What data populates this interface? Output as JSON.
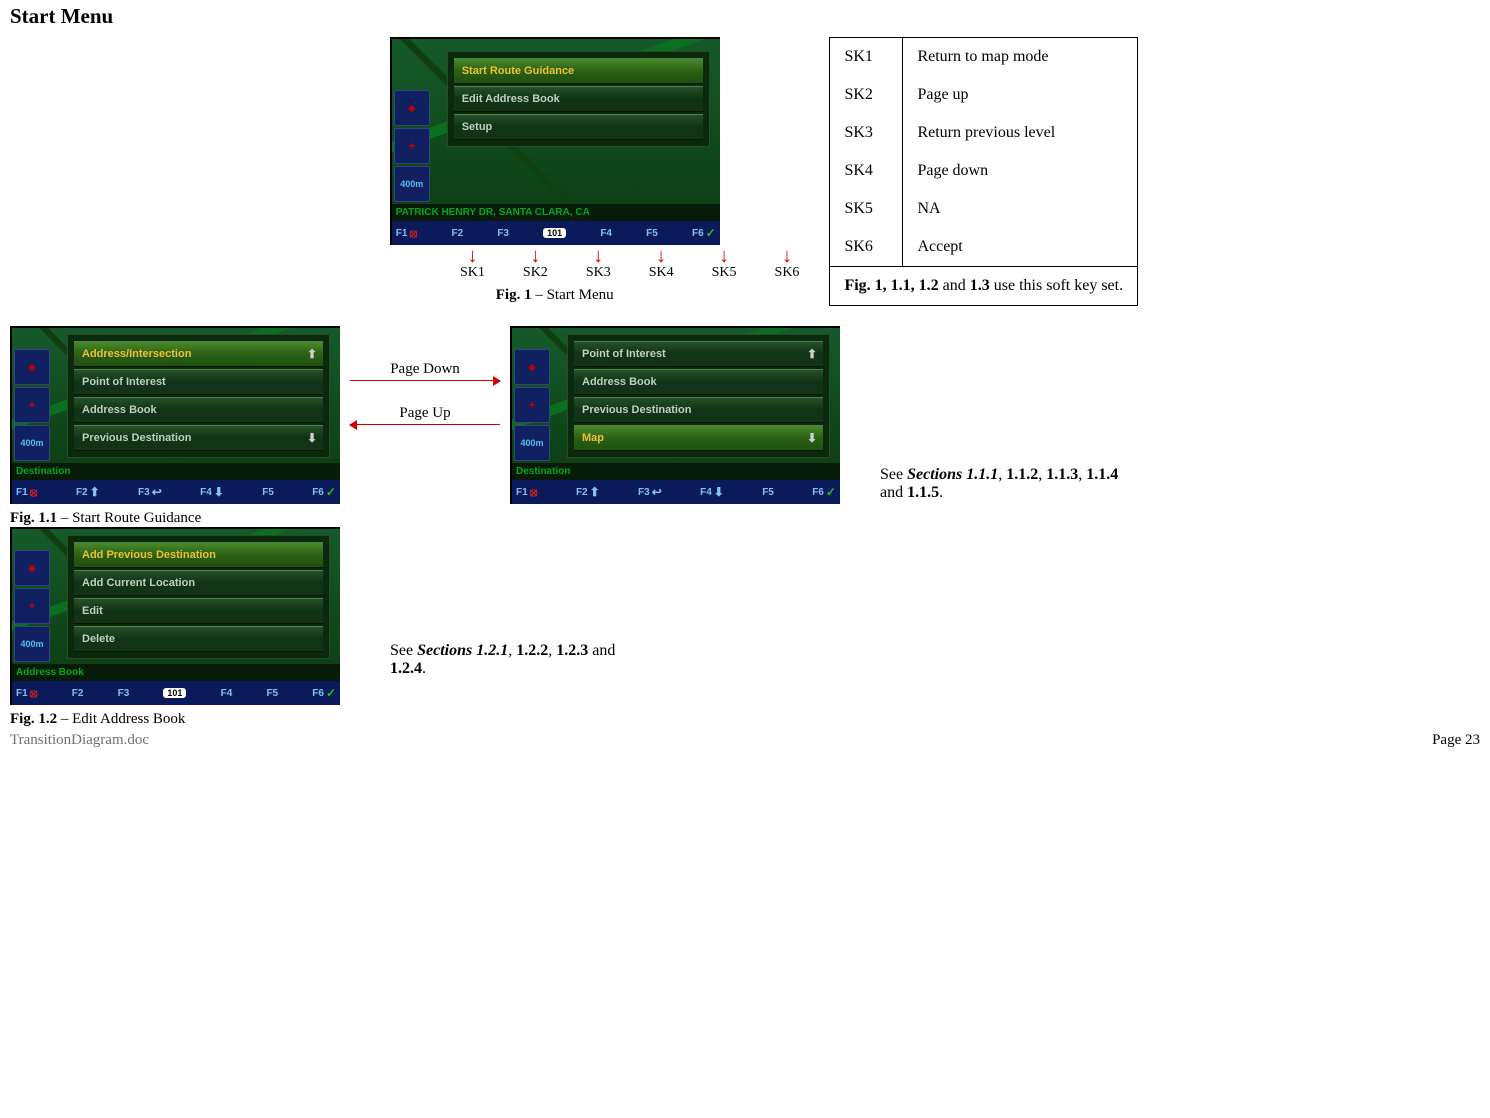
{
  "page_title": "Start Menu",
  "softkeys": {
    "rows": [
      {
        "key": "SK1",
        "desc": "Return to map mode"
      },
      {
        "key": "SK2",
        "desc": "Page up"
      },
      {
        "key": "SK3",
        "desc": "Return previous level"
      },
      {
        "key": "SK4",
        "desc": "Page down"
      },
      {
        "key": "SK5",
        "desc": "NA"
      },
      {
        "key": "SK6",
        "desc": "Accept"
      }
    ],
    "footnote_bold": "Fig. 1, 1.1, 1.2",
    "footnote_mid": " and ",
    "footnote_bold2": "1.3",
    "footnote_tail": " use this soft key set."
  },
  "sk_labels": [
    "SK1",
    "SK2",
    "SK3",
    "SK4",
    "SK5",
    "SK6"
  ],
  "fig1": {
    "caption_bold": "Fig. 1",
    "caption_rest": " – Start Menu",
    "menu_items": [
      "Start Route Guidance",
      "Edit Address Book",
      "Setup"
    ],
    "status": "PATRICK HENRY DR, SANTA CLARA, CA",
    "scale": "400m",
    "route": "101",
    "fkeys_left": [
      "F1",
      "F2",
      "F3"
    ],
    "fkeys_right": [
      "F4",
      "F5",
      "F6"
    ]
  },
  "fig11": {
    "caption_bold": "Fig. 1.1",
    "caption_rest": " – Start Route Guidance",
    "screenA_items": [
      "Address/Intersection",
      "Point of Interest",
      "Address Book",
      "Previous Destination"
    ],
    "screenB_items": [
      "Point of Interest",
      "Address Book",
      "Previous Destination",
      "Map"
    ],
    "status": "Destination",
    "scale": "400m"
  },
  "fig12": {
    "caption_bold": "Fig. 1.2",
    "caption_rest": " – Edit Address Book",
    "items": [
      "Add Previous Destination",
      "Add Current Location",
      "Edit",
      "Delete"
    ],
    "status": "Address Book",
    "scale": "400m",
    "route": "101"
  },
  "paging": {
    "down": "Page Down",
    "up": "Page Up"
  },
  "see1": {
    "pre": "See ",
    "sections_label": "Sections 1.1.1",
    "mid1": ", ",
    "b2": "1.1.2",
    "mid2": ", ",
    "b3": "1.1.3",
    "mid3": ", ",
    "b4": "1.1.4",
    "mid4": " and ",
    "b5": "1.1.5",
    "tail": "."
  },
  "see2": {
    "pre": "See ",
    "sections_label": "Sections 1.2.1",
    "mid1": ", ",
    "b2": "1.2.2",
    "mid2": ", ",
    "b3": "1.2.3",
    "mid3": " and ",
    "b4": "1.2.4",
    "tail": "."
  },
  "footer": {
    "left": "TransitionDiagram.doc",
    "right": "Page 23"
  }
}
